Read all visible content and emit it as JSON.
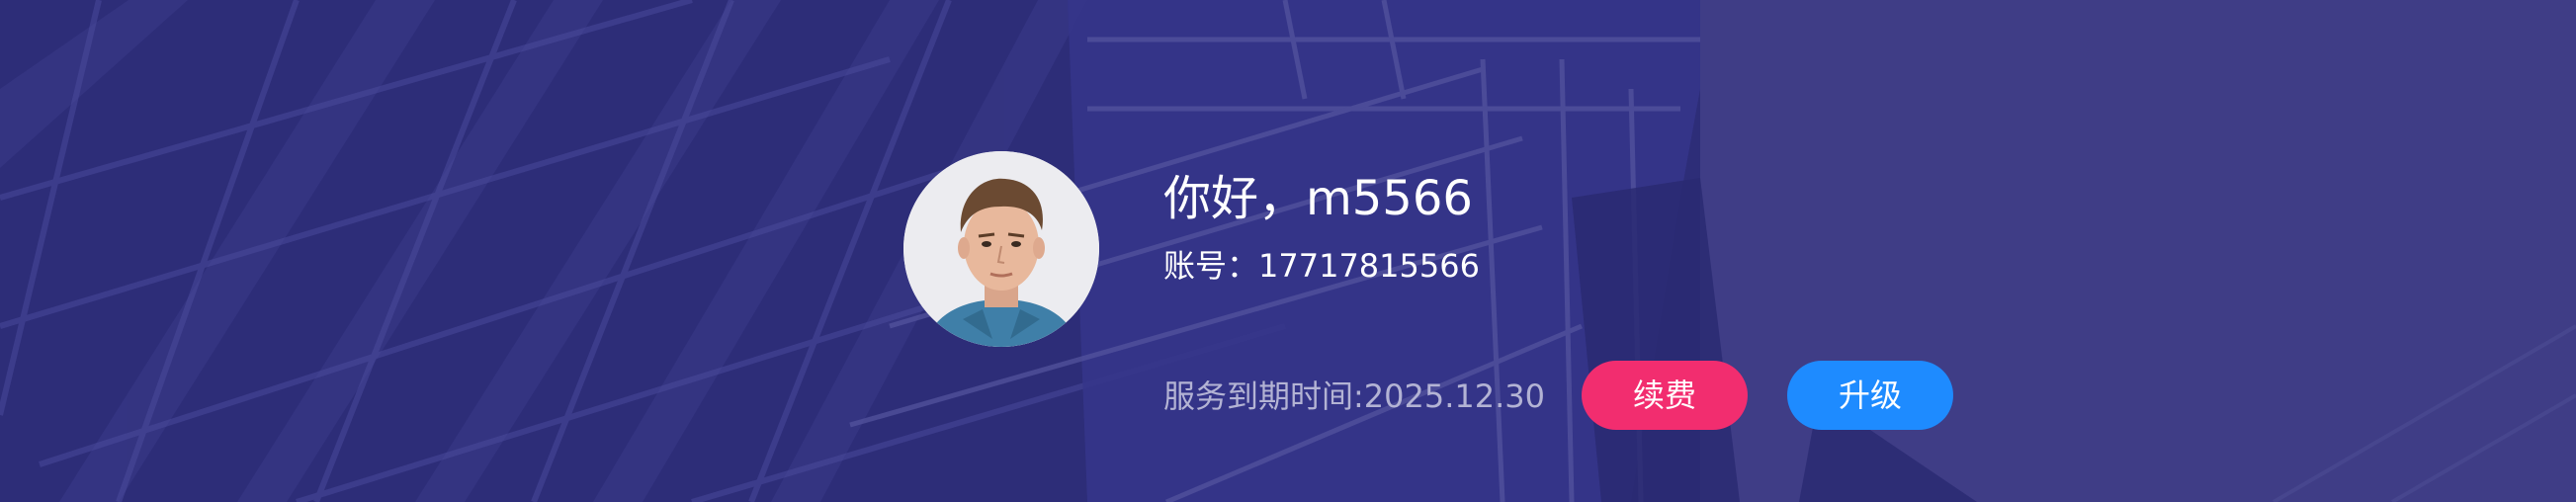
{
  "user": {
    "greeting": "你好，m5566",
    "account": "账号：17717815566",
    "expiry": "服务到期时间:2025.12.30"
  },
  "actions": {
    "renew_label": "续费",
    "upgrade_label": "升级"
  },
  "colors": {
    "background": "#2f2f7d",
    "renew_button": "#f22d6f",
    "upgrade_button": "#1e8bff",
    "expiry_text": "#b3b3d4"
  },
  "icons": {
    "avatar": "user-portrait"
  }
}
